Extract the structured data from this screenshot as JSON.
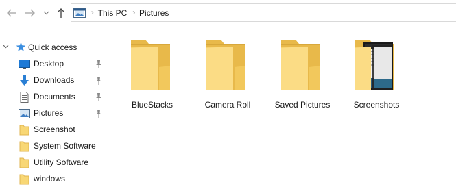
{
  "toolbar": {
    "back_icon": "arrow-left-icon",
    "forward_icon": "arrow-right-icon",
    "recent_icon": "chevron-down-icon",
    "up_icon": "arrow-up-icon"
  },
  "address_bar": {
    "icon": "pictures-location-icon",
    "breadcrumbs": [
      "This PC",
      "Pictures"
    ]
  },
  "sidebar": {
    "quick_access_label": "Quick access",
    "items": [
      {
        "label": "Desktop",
        "icon": "desktop-icon",
        "pinned": true
      },
      {
        "label": "Downloads",
        "icon": "download-icon",
        "pinned": true
      },
      {
        "label": "Documents",
        "icon": "documents-icon",
        "pinned": true
      },
      {
        "label": "Pictures",
        "icon": "pictures-icon",
        "pinned": true
      },
      {
        "label": "Screenshot",
        "icon": "folder-icon",
        "pinned": false
      },
      {
        "label": "System Software",
        "icon": "folder-icon",
        "pinned": false
      },
      {
        "label": "Utility Software",
        "icon": "folder-icon",
        "pinned": false
      },
      {
        "label": "windows",
        "icon": "folder-icon",
        "pinned": false
      }
    ]
  },
  "content": {
    "folders": [
      {
        "name": "BlueStacks"
      },
      {
        "name": "Camera Roll"
      },
      {
        "name": "Saved Pictures"
      },
      {
        "name": "Screenshots"
      }
    ]
  },
  "colors": {
    "folder_light": "#f8d775",
    "folder_dark": "#e8b94a",
    "accent": "#1e7ad6"
  }
}
